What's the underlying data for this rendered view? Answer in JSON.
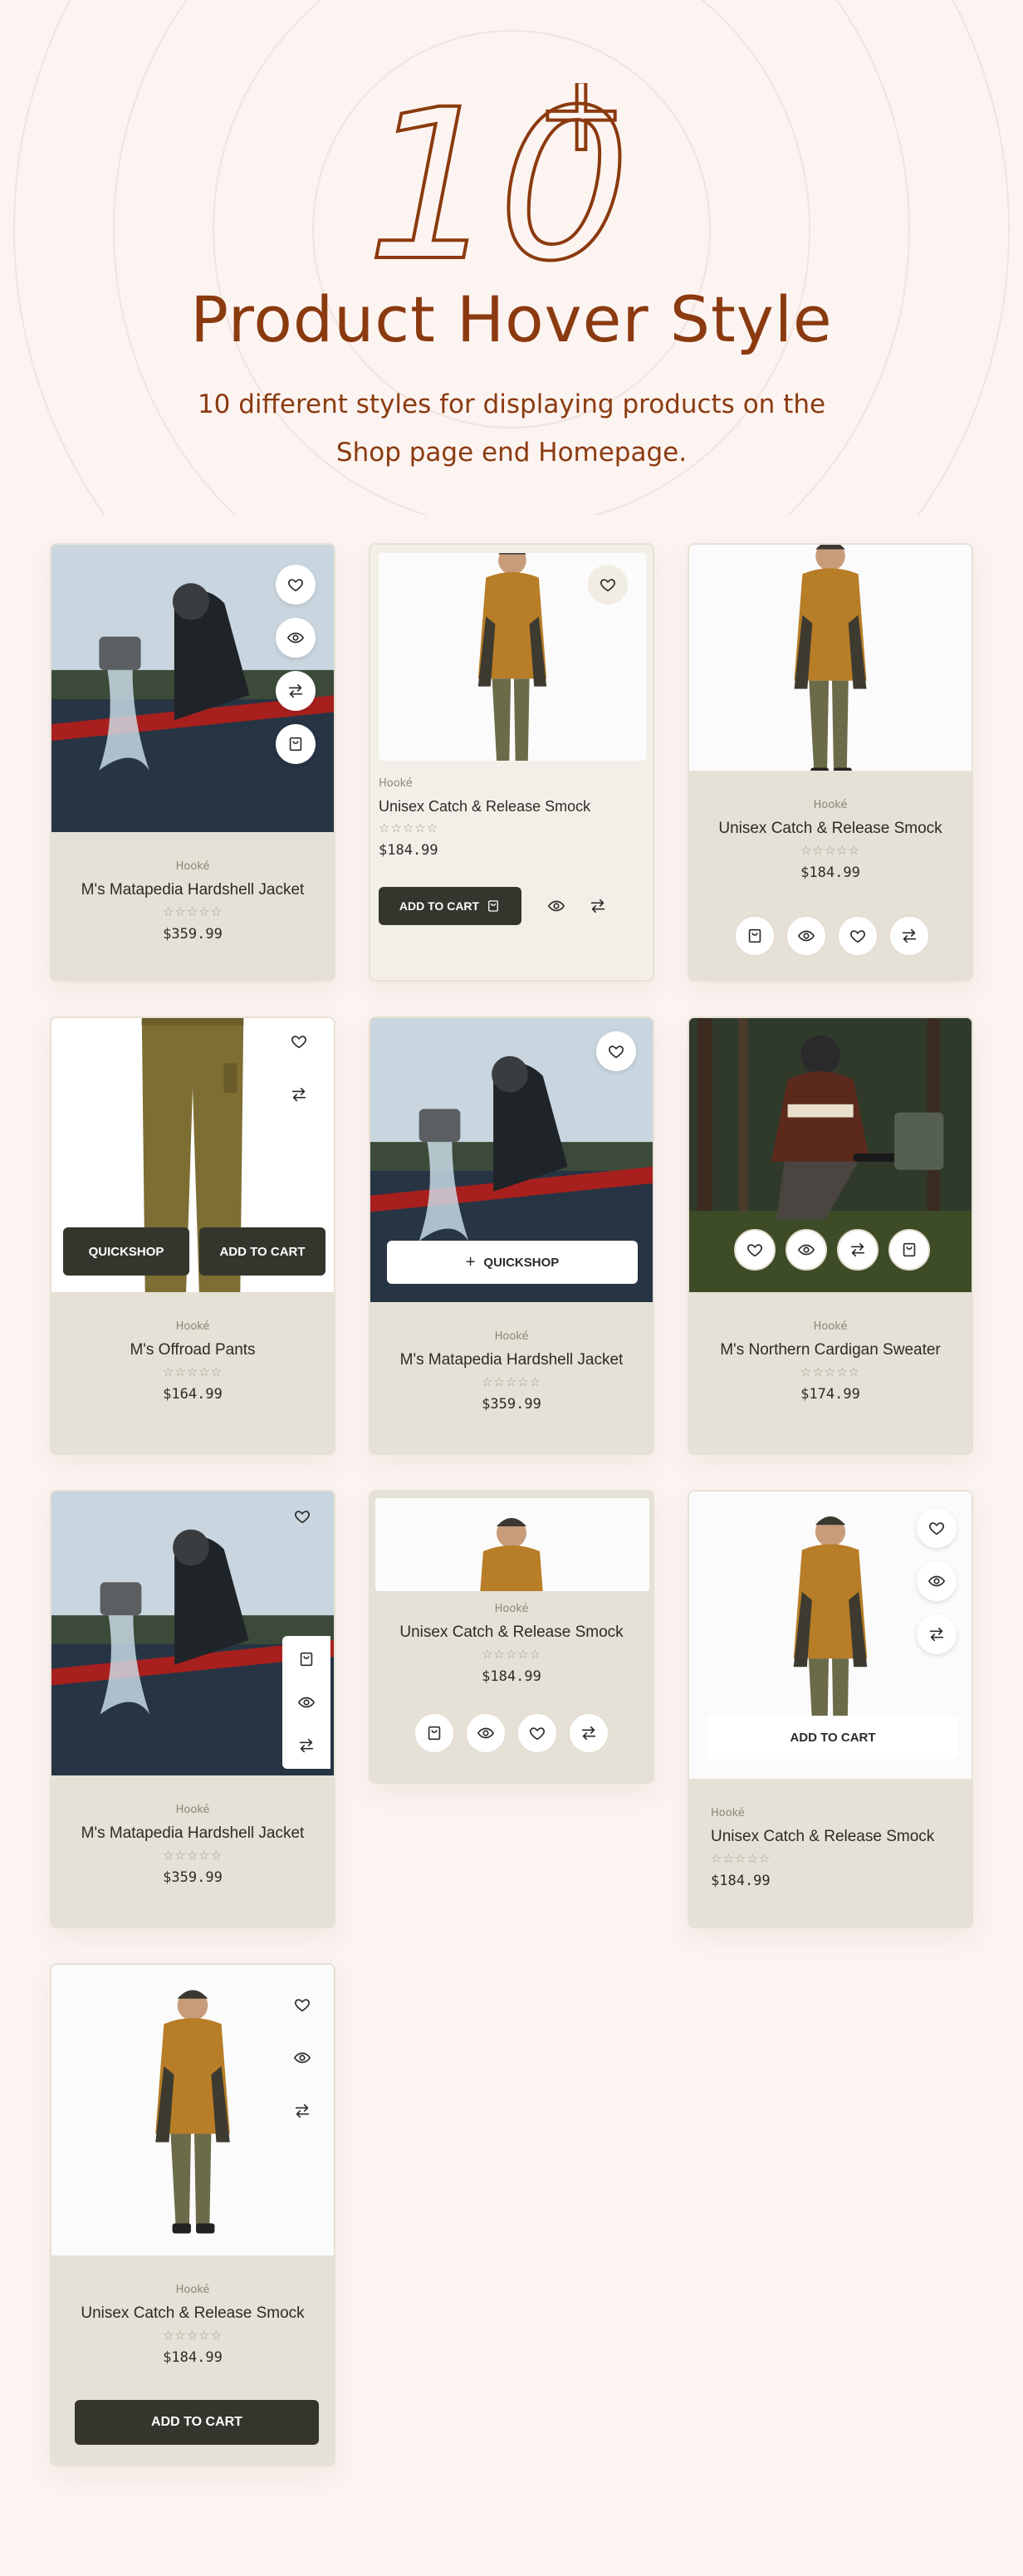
{
  "header": {
    "big_number": "10",
    "big_sup": "+",
    "title": "Product Hover Style",
    "subtitle": "10 different styles for displaying products on the Shop page end Homepage."
  },
  "colors": {
    "accent": "#8b3a0f",
    "background": "#fcf4f1",
    "card": "#e6e1d6",
    "dark": "#34352d"
  },
  "icons": [
    "heart-icon",
    "eye-icon",
    "compare-icon",
    "bag-icon",
    "plus-icon"
  ],
  "products": {
    "jacket": {
      "brand": "Hooké",
      "name": "M's Matapedia Hardshell Jacket",
      "price": "$359.99",
      "rating": "☆☆☆☆☆"
    },
    "smock": {
      "brand": "Hooké",
      "name": "Unisex Catch & Release Smock",
      "price": "$184.99",
      "rating": "☆☆☆☆☆"
    },
    "pants": {
      "brand": "Hooké",
      "name": "M's Offroad Pants",
      "price": "$164.99",
      "rating": "☆☆☆☆☆"
    },
    "sweater": {
      "brand": "Hooké",
      "name": "M's Northern Cardigan Sweater",
      "price": "$174.99",
      "rating": "☆☆☆☆☆"
    }
  },
  "buttons": {
    "add_to_cart_upper": "ADD TO CART",
    "quickshop_upper": "QUICKSHOP"
  }
}
